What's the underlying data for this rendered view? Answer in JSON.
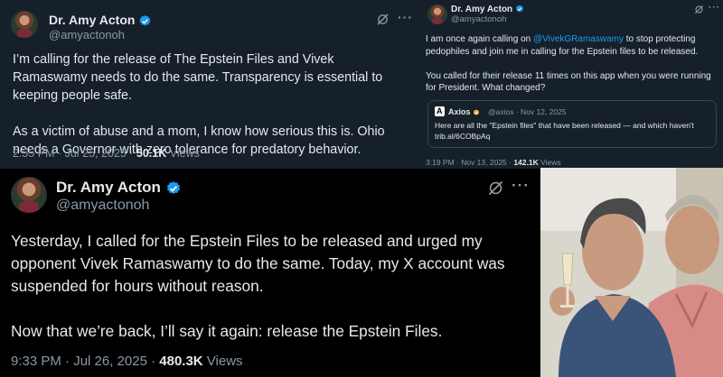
{
  "tweets": [
    {
      "author": "Dr. Amy Acton",
      "handle": "@amyactonoh",
      "paragraphs": [
        "I’m calling for the release of The Epstein Files and Vivek Ramaswamy needs to do the same. Transparency is essential to keeping people safe.",
        "As a victim of abuse and a mom, I know how serious this is. Ohio needs a Governor with zero tolerance for predatory behavior."
      ],
      "time": "2:55 PM · Jul 25, 2025 · ",
      "views_count": "50.1K",
      "views_label": " Views"
    },
    {
      "author": "Dr. Amy Acton",
      "handle": "@amyactonoh",
      "text_before_mention": "I am once again calling on ",
      "mention": "@VivekGRamaswamy",
      "text_after_mention": " to stop protecting pedophiles and join me in calling for the Epstein files to be released.",
      "paragraph2": "You called for their release 11 times on this app when you were running for President. What changed?",
      "quote": {
        "source": "Axios",
        "meta": "@axios · Nov 12, 2025",
        "text": "Here are all the \"Epstein files\" that have been released — and which haven't trib.al/6COBpAq"
      },
      "time": "3:19 PM · Nov 13, 2025 · ",
      "views_count": "142.1K",
      "views_label": " Views"
    },
    {
      "author": "Dr. Amy Acton",
      "handle": "@amyactonoh",
      "paragraphs": [
        "Yesterday, I called for the Epstein Files to be released and urged my opponent Vivek Ramaswamy to do the same. Today, my X account was suspended for hours without reason.",
        "Now that we’re back, I’ll say it again: release the Epstein Files."
      ],
      "time": "9:33 PM · Jul 26, 2025 · ",
      "views_count": "480.3K",
      "views_label": " Views"
    }
  ],
  "icons": {
    "verified": "verified-badge-icon",
    "grok": "grok-icon",
    "more": "more-icon"
  },
  "more_label": "···",
  "colors": {
    "background_dim": "#15202b",
    "background_black": "#000000",
    "text": "#e7e9ea",
    "secondary": "#8b98a5",
    "accent": "#1d9bf0",
    "border": "#38444d"
  }
}
